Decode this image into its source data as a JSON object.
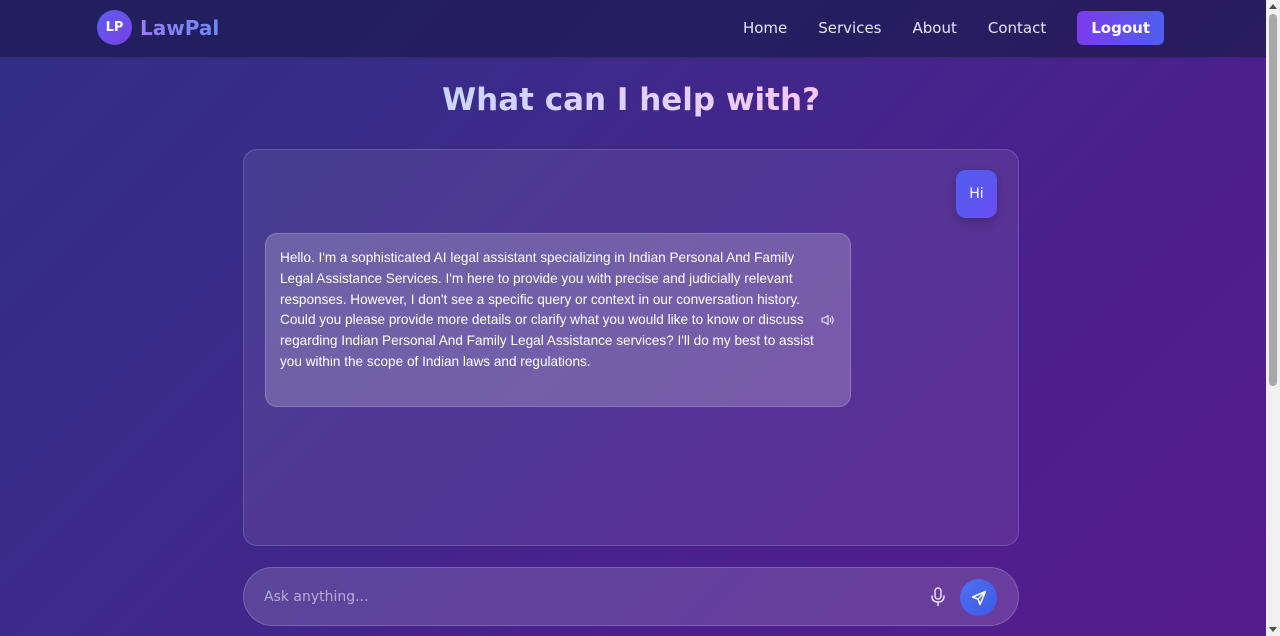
{
  "brand": {
    "badge": "LP",
    "name": "LawPal"
  },
  "nav": {
    "links": [
      "Home",
      "Services",
      "About",
      "Contact"
    ],
    "logout_label": "Logout"
  },
  "heading": "What can I help with?",
  "chat": {
    "messages": [
      {
        "role": "user",
        "text": "Hi"
      },
      {
        "role": "assistant",
        "text": "Hello. I'm a sophisticated AI legal assistant specializing in Indian Personal And Family Legal Assistance Services. I'm here to provide you with precise and judicially relevant responses. However, I don't see a specific query or context in our conversation history. Could you please provide more details or clarify what you would like to know or discuss regarding Indian Personal And Family Legal Assistance services? I'll do my best to assist you within the scope of Indian laws and regulations."
      }
    ]
  },
  "input": {
    "placeholder": "Ask anything...",
    "value": ""
  },
  "icons": {
    "speaker": "speaker-icon",
    "mic": "microphone-icon",
    "send": "send-icon"
  },
  "colors": {
    "accent": "#4f5ff0",
    "logout_gradient_start": "#7c3aed",
    "background": "#3d2a8a"
  }
}
